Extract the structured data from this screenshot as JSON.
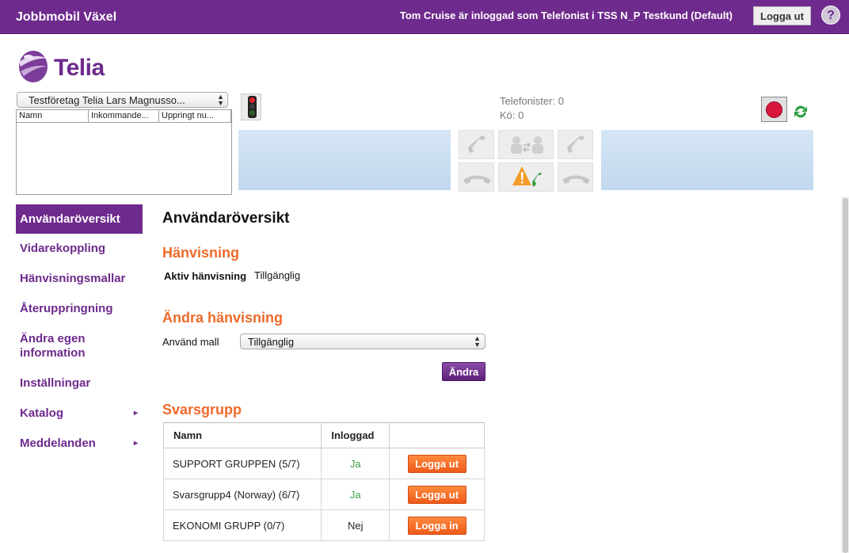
{
  "topbar": {
    "app_title": "Jobbmobil Växel",
    "user_info": "Tom Cruise är inloggad som Telefonist i TSS N_P Testkund (Default)",
    "logout_label": "Logga ut",
    "help_glyph": "?",
    "background_color": "#6e2a8d"
  },
  "logo": {
    "text": "Telia",
    "icon": "telia-logo-icon",
    "color": "#6e2a8d"
  },
  "company": {
    "selected": "Testföretag Telia Lars Magnusso...",
    "columns": [
      "Namn",
      "Inkommande...",
      "Uppringt nu..."
    ]
  },
  "status": {
    "telefonister": "Telefonister: 0",
    "queue": "Kö: 0"
  },
  "icons": {
    "traffic_light": "traffic-light-icon",
    "record": "record-icon",
    "refresh": "refresh-icon",
    "answer": "phone-answer-icon",
    "transfer": "transfer-icon",
    "hangup": "phone-hangup-icon",
    "warning": "warning-call-icon"
  },
  "sidebar": {
    "items": [
      {
        "label": "Användaröversikt",
        "active": true
      },
      {
        "label": "Vidarekoppling"
      },
      {
        "label": "Hänvisningsmallar"
      },
      {
        "label": "Återuppringning"
      },
      {
        "label": "Ändra egen information"
      },
      {
        "label": "Inställningar"
      },
      {
        "label": "Katalog",
        "chevron": "▸"
      },
      {
        "label": "Meddelanden",
        "chevron": "▸"
      }
    ]
  },
  "main": {
    "title": "Användaröversikt",
    "hanvisning": {
      "heading": "Hänvisning",
      "aktiv_label": "Aktiv hänvisning",
      "aktiv_value": "Tillgänglig"
    },
    "andra": {
      "heading": "Ändra hänvisning",
      "mall_label": "Använd mall",
      "mall_selected": "Tillgänglig",
      "button_label": "Ändra"
    },
    "svarsgrupp": {
      "heading": "Svarsgrupp",
      "headers": [
        "Namn",
        "Inloggad",
        ""
      ],
      "rows": [
        {
          "name": "SUPPORT GRUPPEN (5/7)",
          "logged_in": "Ja",
          "action": "Logga ut"
        },
        {
          "name": "Svarsgrupp4 (Norway) (6/7)",
          "logged_in": "Ja",
          "action": "Logga ut"
        },
        {
          "name": "EKONOMI GRUPP (0/7)",
          "logged_in": "Nej",
          "action": "Logga in"
        }
      ]
    }
  },
  "colors": {
    "accent_orange": "#ee6a2a",
    "ja_green": "#3da34a",
    "panel_blue": "#cadff2",
    "record_red": "#d9173c"
  }
}
